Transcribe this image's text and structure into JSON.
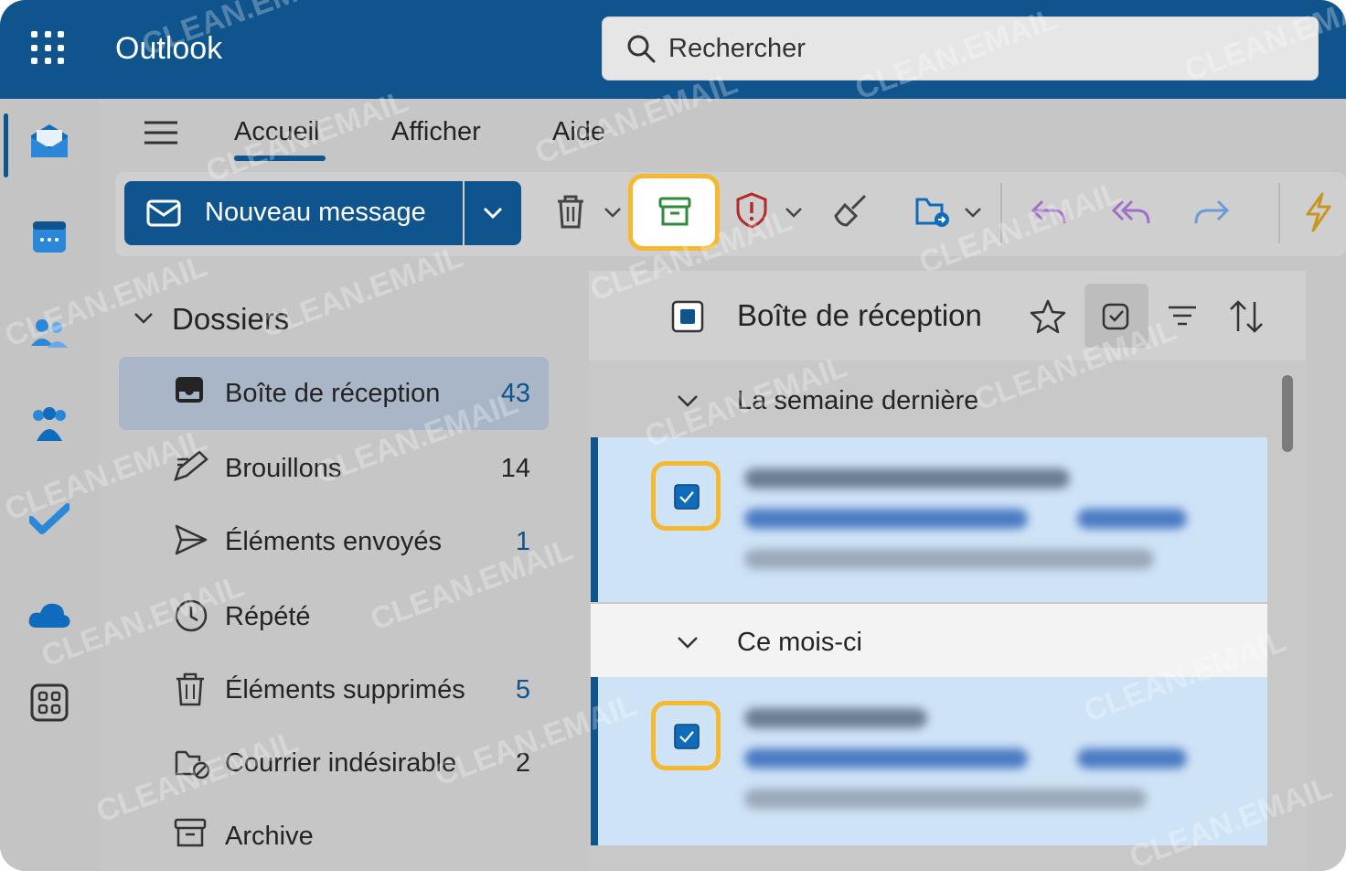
{
  "app": {
    "title": "Outlook"
  },
  "search": {
    "placeholder": "Rechercher"
  },
  "tabs": [
    {
      "label": "Accueil",
      "active": true
    },
    {
      "label": "Afficher"
    },
    {
      "label": "Aide"
    }
  ],
  "ribbon": {
    "new_message": "Nouveau message",
    "highlighted_action": "archive"
  },
  "folders": {
    "heading": "Dossiers",
    "items": [
      {
        "name": "Boîte de réception",
        "count": "43",
        "selected": true,
        "icon": "inbox-icon"
      },
      {
        "name": "Brouillons",
        "count": "14",
        "icon": "drafts-icon"
      },
      {
        "name": "Éléments envoyés",
        "count": "1",
        "icon": "sent-icon"
      },
      {
        "name": "Répété",
        "count": "",
        "icon": "clock-icon"
      },
      {
        "name": "Éléments supprimés",
        "count": "5",
        "icon": "trash-icon"
      },
      {
        "name": "Courrier indésirable",
        "count": "2",
        "icon": "junk-icon"
      },
      {
        "name": "Archive",
        "count": "",
        "icon": "archive-icon"
      }
    ]
  },
  "message_list": {
    "title": "Boîte de réception",
    "groups": [
      {
        "label": "La semaine dernière"
      },
      {
        "label": "Ce mois-ci"
      }
    ]
  },
  "colors": {
    "brand": "#0f548c",
    "highlight": "#f5b82e",
    "selected_row": "#cfe3f7"
  },
  "watermark": "CLEAN.EMAIL"
}
